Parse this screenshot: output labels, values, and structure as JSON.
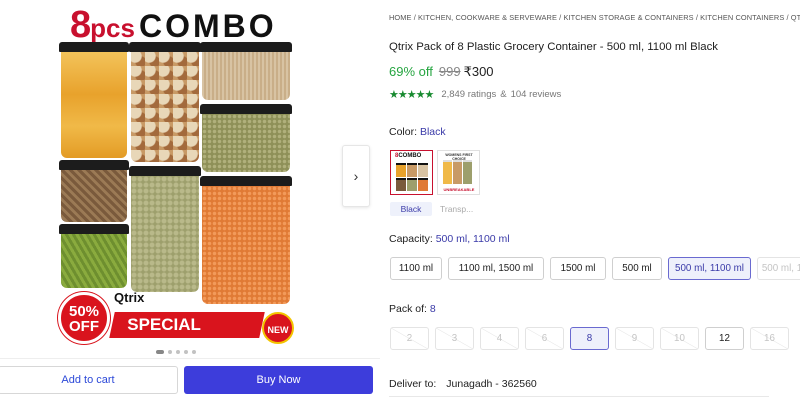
{
  "banner": {
    "count": "8",
    "pcs": "pcs",
    "combo": "COMBO"
  },
  "promo": {
    "percent": "50%",
    "off": "OFF",
    "brand": "Qtrix",
    "ribbon": "SPECIAL OFFER",
    "new": "NEW"
  },
  "gallery": {
    "next_icon": "chevron-right-icon",
    "dot_count": 5,
    "active_dot": 0
  },
  "actions": {
    "add_to_cart": "Add to cart",
    "buy_now": "Buy Now"
  },
  "product": {
    "breadcrumb": "HOME / KITCHEN, COOKWARE & SERVEWARE / KITCHEN STORAGE & CONTAINERS / KITCHEN CONTAINERS / QTRIX KITCHEN CONTAINERS",
    "title": "Qtrix Pack of 8 Plastic Grocery Container  - 500 ml, 1100 ml Black",
    "discount": "69% off",
    "mrp": "999",
    "price": "₹300",
    "stars": "★★★★★",
    "rating_value": 4.5,
    "ratings": "2,849 ratings",
    "amp": "&",
    "reviews": "104 reviews"
  },
  "color": {
    "label": "Color:",
    "selected": "Black",
    "options": [
      {
        "label": "Black",
        "selected": true
      },
      {
        "label": "Transp...",
        "selected": false
      }
    ],
    "thumb2_text": "WOMENS FIRST CHOICE",
    "thumb2_sub": "UNBREAKABLE"
  },
  "capacity": {
    "label": "Capacity:",
    "selected": "500 ml, 1100 ml",
    "options": [
      "1100 ml",
      "1100 ml, 1500 ml",
      "1500 ml",
      "500 ml",
      "500 ml, 1100 ml",
      "500 ml, 1"
    ]
  },
  "pack": {
    "label": "Pack of:",
    "selected": "8",
    "options": [
      "2",
      "3",
      "4",
      "6",
      "8",
      "9",
      "10",
      "12",
      "16"
    ]
  },
  "delivery": {
    "label": "Deliver to:",
    "location": "Junagadh - 362560"
  },
  "colors": {
    "accent": "#3d3ddb",
    "discount": "#26a541",
    "promo_red": "#d9141d",
    "rating_green": "#178a2f"
  }
}
